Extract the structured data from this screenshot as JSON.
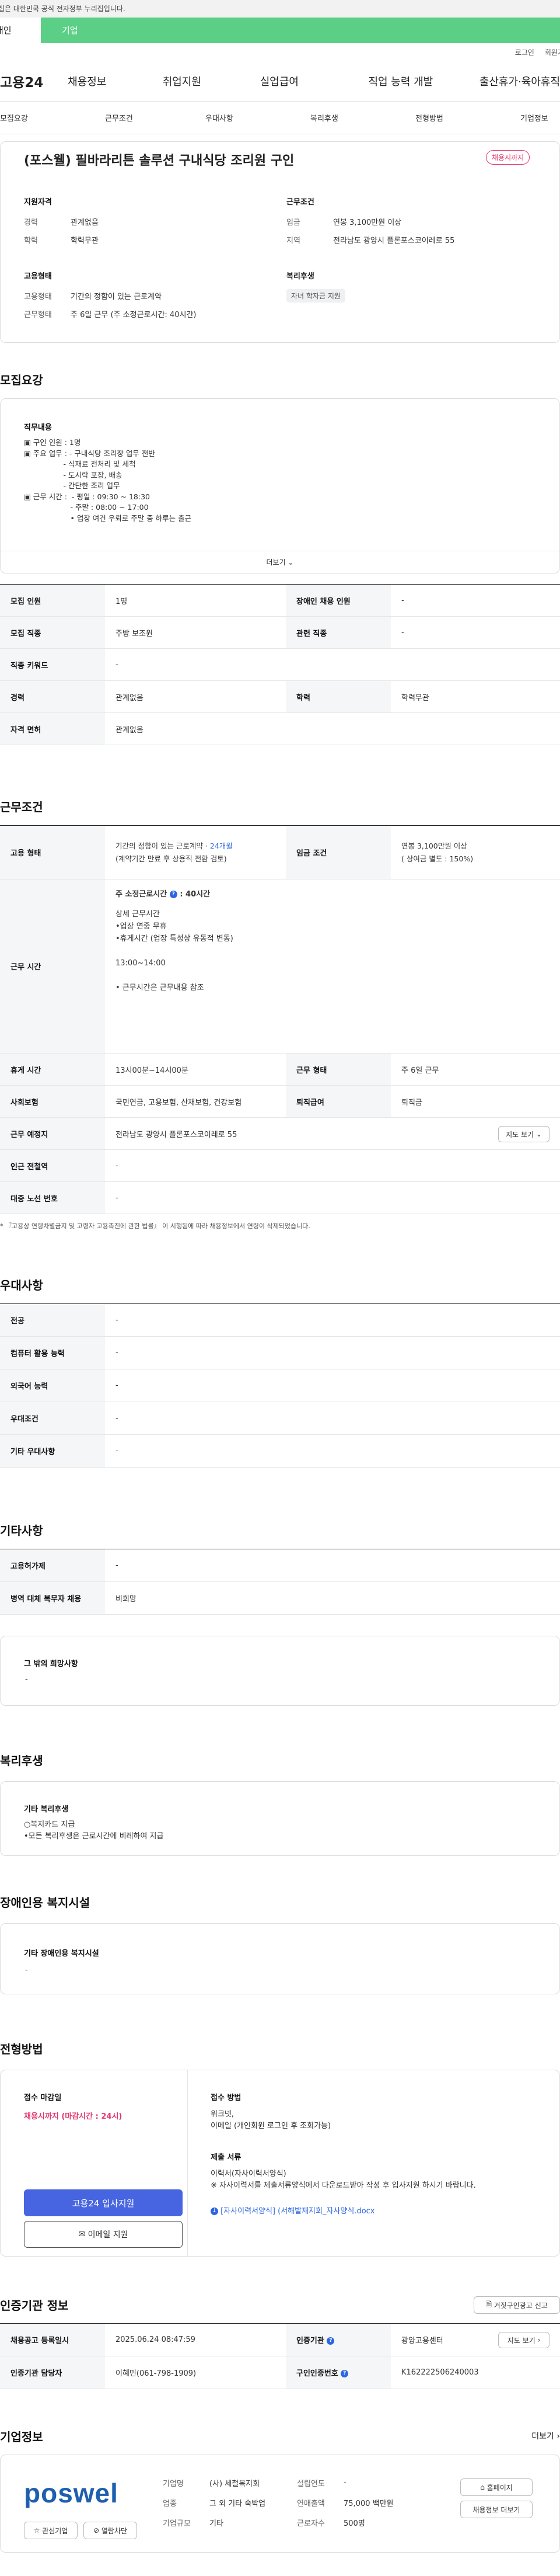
{
  "gov_banner": "이 누리집은 대한민국 공식 전자정부 누리집입니다.",
  "user_tabs": [
    "개인",
    "기업"
  ],
  "top_links": [
    "로그인",
    "회원가입"
  ],
  "logo": "고용24",
  "gnb": [
    "채용정보",
    "취업지원",
    "실업급여",
    "직업 능력 개발",
    "출산휴가·육아휴직"
  ],
  "subnav": [
    "모집요강",
    "근무조건",
    "우대사항",
    "복리후생",
    "전형방법",
    "기업정보"
  ],
  "job": {
    "title": "(포스웰) 필바라리튼 솔루션 구내식당 조리원 구인",
    "status_badge": "채용시까지",
    "req_heading": "지원자격",
    "career_k": "경력",
    "career_v": "관계없음",
    "edu_k": "학력",
    "edu_v": "학력무관",
    "emp_heading": "고용형태",
    "emptype_k": "고용형태",
    "emptype_v": "기간의 정함이 있는 근로계약",
    "workform_k": "근무형태",
    "workform_v": "주 6일 근무 (주 소정근로시간: 40시간)",
    "cond_heading": "근무조건",
    "wage_k": "임금",
    "wage_v": "연봉 3,100만원 이상",
    "region_k": "지역",
    "region_v": "전라남도 광양시 플론포스코이레로 55",
    "welfare_heading": "복리후생",
    "welfare_tag": "자녀 학자금 지원"
  },
  "sec_recruit": "모집요강",
  "duty": {
    "heading": "직무내용",
    "lines": [
      "▣ 구인 인원 : 1명",
      "▣ 주요 업무 : - 구내식당 조리장 업무 전반",
      "                 - 식재료 전처리 및 세척",
      "                 - 도시락 포장, 배송",
      "                 - 간단한 조리 업무",
      "",
      "▣ 근무 시간 :  - 평일 : 09:30 ~ 18:30",
      "                    - 주말 : 08:00 ~ 17:00",
      "                    • 업장 여건 우뢰로 주말 중 하루는 출근"
    ],
    "more": "더보기"
  },
  "recruit_table": {
    "r1": [
      "모집 인원",
      "1명",
      "장애인 채용 인원",
      "-"
    ],
    "r2": [
      "모집 직종",
      "주방 보조원",
      "관련 직종",
      "-"
    ],
    "r3": [
      "직종 키워드",
      "-"
    ],
    "r4": [
      "경력",
      "관계없음",
      "학력",
      "학력무관"
    ],
    "r5": [
      "자격 면허",
      "관계없음"
    ]
  },
  "sec_cond": "근무조건",
  "cond_table": {
    "emptype_k": "고용 형태",
    "emptype_v1": "기간의 정함이 있는 근로계약 · ",
    "emptype_period": "24개월",
    "emptype_v2": "(계약기간 만료 후 상용직 전환 검토)",
    "wage_k": "임금 조건",
    "wage_v1": "연봉 3,100만원 이상",
    "wage_v2": "( 상여금 별도 : 150%)",
    "worktime_k": "근무 시간",
    "worktime_title": "주 소정근로시간",
    "worktime_title2": ": 40시간",
    "worktime_lines": [
      "상세 근무시간",
      "•업장 연중 무휴",
      "•휴게시간 (업장 특성상 유동적 변동)",
      "",
      "13:00~14:00",
      "",
      "• 근무시간은 근무내용 참조"
    ],
    "rest_k": "휴게 시간",
    "rest_v": "13시00분~14시00분",
    "form_k": "근무 형태",
    "form_v": "주 6일 근무",
    "ins_k": "사회보험",
    "ins_v": "국민연금, 고용보험, 산재보험, 건강보험",
    "ret_k": "퇴직급여",
    "ret_v": "퇴직금",
    "place_k": "근무 예정지",
    "place_v": "전라남도 광양시 플론포스코이레로 55",
    "map_btn": "지도 보기",
    "sub_k": "인근 전철역",
    "sub_v": "-",
    "bus_k": "대중 노선 번호",
    "bus_v": "-"
  },
  "notice": "* 『고용상 연령차별금지 및 고령자 고용촉진에 관한 법률』 이 시행됨에 따라 채용정보에서 연령이 삭제되었습니다.",
  "sec_pref": "우대사항",
  "pref_rows": [
    [
      "전공",
      "-"
    ],
    [
      "컴퓨터 활용 능력",
      "-"
    ],
    [
      "외국어 능력",
      "-"
    ],
    [
      "우대조건",
      "-"
    ],
    [
      "기타 우대사항",
      "-"
    ]
  ],
  "sec_etc": "기타사항",
  "etc_rows": [
    [
      "고용허가제",
      "-"
    ],
    [
      "병역 대체 복무자 채용",
      "비희망"
    ]
  ],
  "etc_other": {
    "heading": "그 밖의 희망사항",
    "value": "-"
  },
  "sec_welfare": "복리후생",
  "welfare_box": {
    "heading": "기타 복리후생",
    "lines": [
      "○복지카드 지급",
      "•모든 복리후생은 근로시간에 비례하여 지급"
    ]
  },
  "sec_disabled": "장애인용 복지시설",
  "disabled_box": {
    "heading": "기타 장애인용 복지시설",
    "value": "-"
  },
  "sec_process": "전형방법",
  "process": {
    "deadline_h": "접수 마감일",
    "deadline_v": "채용시까지 (마감시간 : 24시)",
    "apply_btn": "고용24 입사지원",
    "email_btn": "이메일 지원",
    "method_h": "접수 방법",
    "method_lines": [
      "워크넷,",
      "이메일 (개인회원 로그인 후 조회가능)"
    ],
    "docs_h": "제출 서류",
    "docs_lines": [
      "이력서(자사이력서양식)",
      "※ 자사이력서를 제출서류양식에서 다운로드받아 작성 후 입사지원 하시기 바랍니다."
    ],
    "file": "[자사이력서양식] (서해발재지회_자사양식.docx"
  },
  "sec_cert": "인증기관 정보",
  "cert_report_btn": "거짓구인광고 신고",
  "cert": {
    "reg_k": "채용공고 등록일시",
    "reg_v": "2025.06.24 08:47:59",
    "org_k": "인증기관",
    "org_v": "광양고용센터",
    "map_btn": "지도 보기",
    "mgr_k": "인증기관 담당자",
    "mgr_v": "이혜민(061-798-1909)",
    "num_k": "구인인증번호",
    "num_v": "K162222506240003"
  },
  "sec_company": "기업정보",
  "company_more": "더보기",
  "company": {
    "logo": "poswel",
    "fav_btn": "관심기업",
    "block_btn": "열람차단",
    "rows": [
      [
        "기업명",
        "(사) 세철복지회",
        "설립연도",
        "-"
      ],
      [
        "업종",
        "그 외 기타 숙박업",
        "연매출액",
        "75,000 백만원"
      ],
      [
        "기업규모",
        "기타",
        "근로자수",
        "500명"
      ]
    ],
    "home_btn": "홈페이지",
    "jobs_btn": "채용정보 더보기"
  },
  "colors": {
    "brand_green": "#5ccf86",
    "accent_blue": "#4765e0",
    "status_pink": "#e3386e"
  }
}
